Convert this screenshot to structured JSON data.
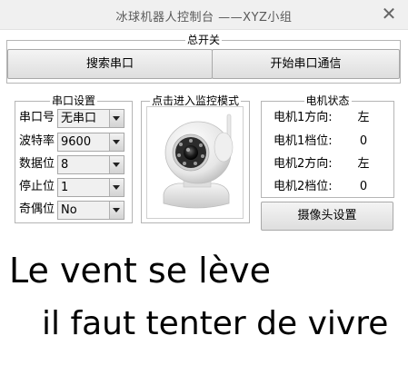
{
  "window": {
    "title": "冰球机器人控制台   ——XYZ小组",
    "close_glyph": "✕"
  },
  "master_switch": {
    "legend": "总开关",
    "search_button": "搜索串口",
    "open_button": "开始串口通信"
  },
  "serial_settings": {
    "legend": "串口设置",
    "rows": [
      {
        "label": "串口号",
        "value": "无串口"
      },
      {
        "label": "波特率",
        "value": "9600"
      },
      {
        "label": "数据位",
        "value": "8"
      },
      {
        "label": "停止位",
        "value": "1"
      },
      {
        "label": "奇偶位",
        "value": "No"
      }
    ]
  },
  "monitor": {
    "legend": "点击进入监控模式",
    "image": "white-ptz-ip-camera-icon"
  },
  "motor_status": {
    "legend": "电机状态",
    "rows": [
      {
        "label": "电机1方向:",
        "value": "左"
      },
      {
        "label": "电机1档位:",
        "value": "0"
      },
      {
        "label": "电机2方向:",
        "value": "左"
      },
      {
        "label": "电机2档位:",
        "value": "0"
      }
    ],
    "camera_settings_button": "摄像头设置"
  },
  "slogan": {
    "line1": "Le vent se lève",
    "line2": "il faut tenter de vivre"
  },
  "colors": {
    "button_border": "#a9a9a9",
    "group_border": "#b5b5b5",
    "titlebar": "#f0f0f0"
  }
}
